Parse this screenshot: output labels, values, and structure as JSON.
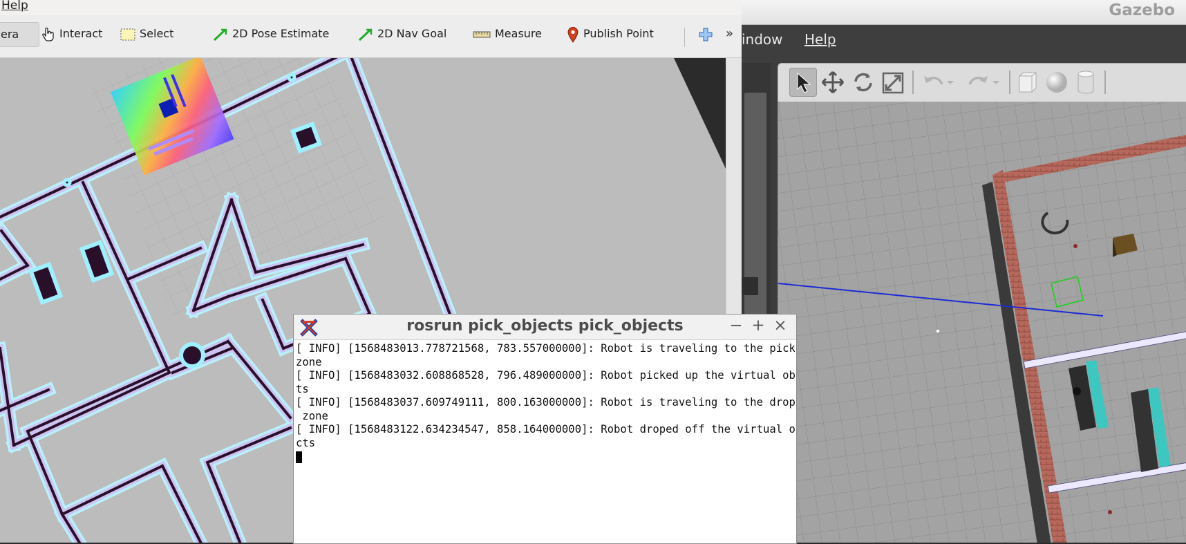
{
  "rviz": {
    "menu": {
      "help": "Help"
    },
    "toolbar": {
      "camera_partial": "era",
      "interact": "Interact",
      "select": "Select",
      "pose_estimate": "2D Pose Estimate",
      "nav_goal": "2D Nav Goal",
      "measure": "Measure",
      "publish_point": "Publish Point",
      "overflow": "»"
    },
    "colors": {
      "map_free": "#bcbcbc",
      "wall": "#2a0f2a",
      "costmap_inflation": "#80ffff"
    }
  },
  "gazebo": {
    "title": "Gazebo",
    "menu": {
      "window_partial": "indow",
      "help": "Help"
    }
  },
  "terminal": {
    "title": "rosrun pick_objects pick_objects",
    "controls": {
      "minimize": "−",
      "maximize": "+",
      "close": "×"
    },
    "lines": [
      "[ INFO] [1568483013.778721568, 783.557000000]: Robot is traveling to the pickup",
      "zone",
      "[ INFO] [1568483032.608868528, 796.489000000]: Robot picked up the virtual objec",
      "ts",
      "[ INFO] [1568483037.609749111, 800.163000000]: Robot is traveling to the dropoff",
      " zone",
      "[ INFO] [1568483122.634234547, 858.164000000]: Robot droped off the virtual obje",
      "cts"
    ]
  }
}
